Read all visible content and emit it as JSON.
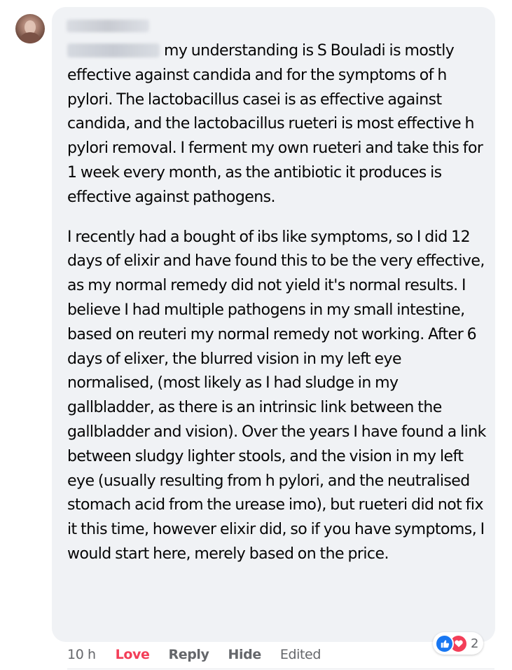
{
  "comment": {
    "paragraph_1": "my understanding is S Bouladi is mostly effective against candida and for the symptoms of h pylori. The lactobacillus casei is as effective against candida, and the lactobacillus rueteri is most effective h pylori removal. I ferment my own rueteri and take this for 1 week every month, as the antibiotic it produces is effective against pathogens.",
    "paragraph_2": "I recently had a bought of ibs like symptoms, so I did 12 days of elixir and have found this to be the very effective, as my normal remedy did not yield it's normal results. I believe I had multiple pathogens in my small intestine, based on reuteri my normal remedy not working. After 6 days of elixer, the blurred vision in my left eye normalised, (most likely as I had sludge in my gallbladder, as there is an intrinsic link between the gallbladder and vision). Over the years I have found a link between sludgy lighter stools, and the vision in my left eye (usually resulting from h pylori, and the neutralised stomach acid from the urease imo), but rueteri did not fix it this time, however elixir did, so if you have symptoms, I would start here, merely based on the price."
  },
  "actions": {
    "time": "10 h",
    "love_label": "Love",
    "reply_label": "Reply",
    "hide_label": "Hide",
    "edited_label": "Edited"
  },
  "reactions": {
    "count": "2",
    "icons": [
      "like-icon",
      "heart-icon"
    ]
  },
  "colors": {
    "bubble_bg": "#f0f2f5",
    "love": "#f33e58",
    "like_blue": "#1877f2",
    "secondary_text": "#65676b"
  }
}
